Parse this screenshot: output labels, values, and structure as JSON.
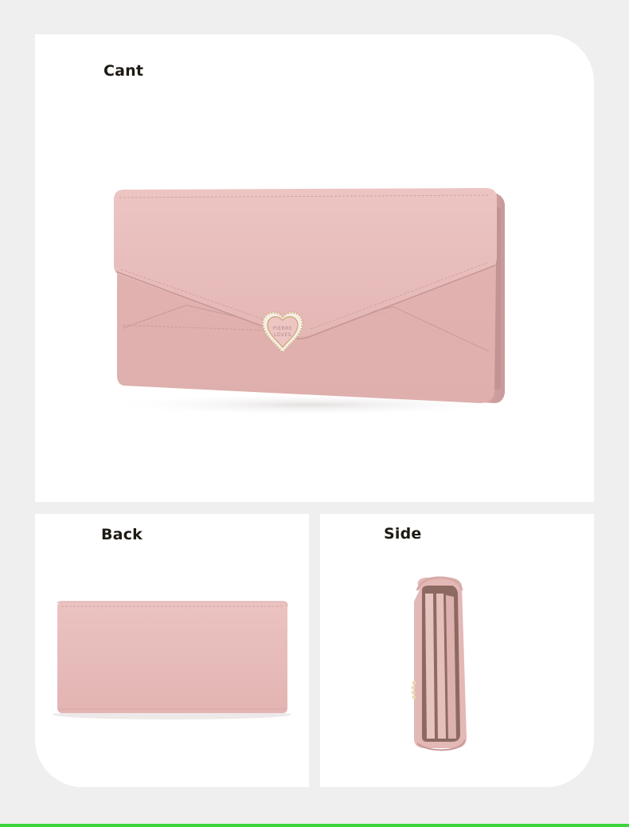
{
  "panels": {
    "top": {
      "label": "Cant"
    },
    "back": {
      "label": "Back"
    },
    "side": {
      "label": "Side"
    }
  },
  "product": {
    "brand_line1": "PIERRE",
    "brand_line2": "LOVES"
  },
  "colors": {
    "background": "#efeff0",
    "panel": "#ffffff",
    "wallet_pink": "#e9bfbd",
    "accent_line": "#3cd43c"
  }
}
